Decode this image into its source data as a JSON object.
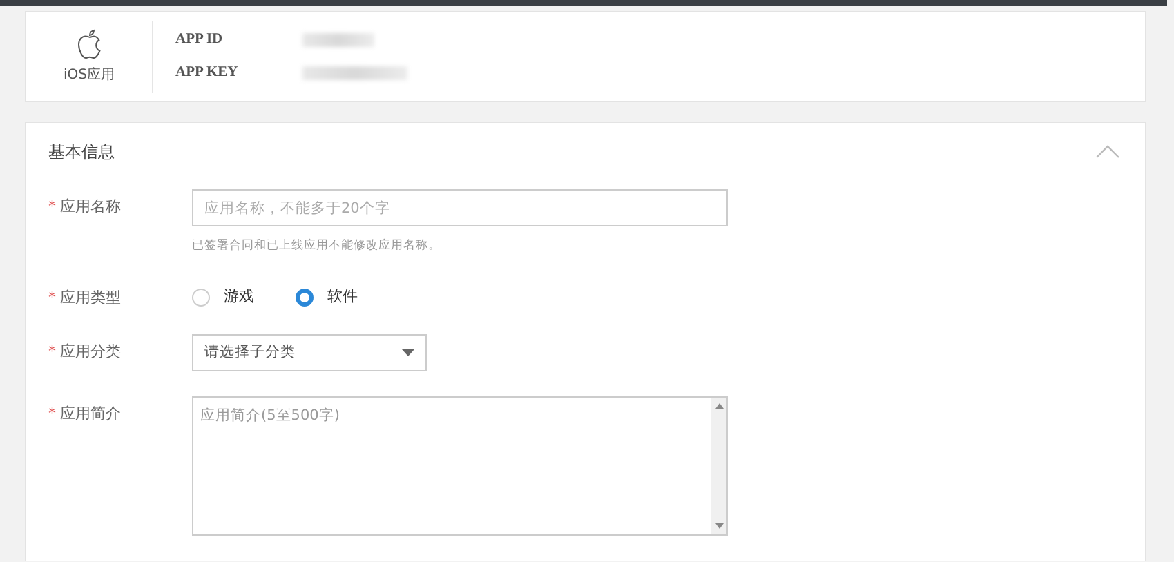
{
  "app_card": {
    "platform_label": "iOS应用",
    "fields": [
      {
        "label": "APP ID"
      },
      {
        "label": "APP KEY"
      }
    ]
  },
  "section": {
    "title": "基本信息",
    "expanded": true,
    "fields": [
      {
        "kind": "text",
        "label": "应用名称",
        "required_mark": "*",
        "placeholder": "应用名称，不能多于20个字",
        "hint": "已签署合同和已上线应用不能修改应用名称。"
      },
      {
        "kind": "radio",
        "label": "应用类型",
        "required_mark": "*",
        "options": [
          {
            "label": "游戏",
            "selected": false
          },
          {
            "label": "软件",
            "selected": true
          }
        ]
      },
      {
        "kind": "select",
        "label": "应用分类",
        "required_mark": "*",
        "value": "请选择子分类"
      },
      {
        "kind": "textarea",
        "label": "应用简介",
        "required_mark": "*",
        "placeholder": "应用简介(5至500字)"
      }
    ]
  }
}
